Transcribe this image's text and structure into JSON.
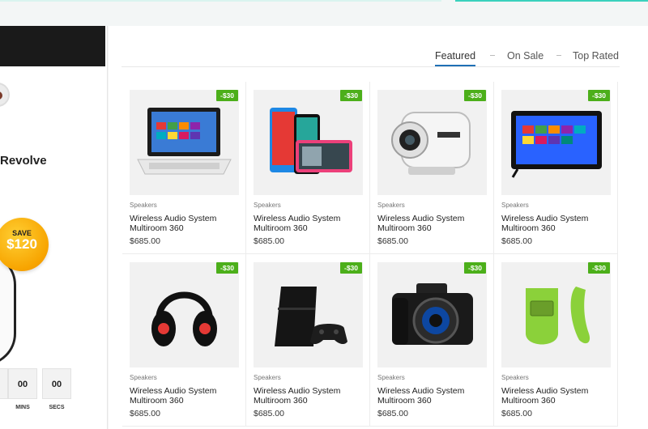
{
  "deal": {
    "title": "Revolve",
    "save_label": "SAVE",
    "save_amount": "$120",
    "timer": [
      {
        "value": "",
        "label": ""
      },
      {
        "value": "00",
        "label": "MINS"
      },
      {
        "value": "00",
        "label": "SECS"
      }
    ]
  },
  "tabs": [
    {
      "label": "Featured",
      "active": true
    },
    {
      "label": "On Sale",
      "active": false
    },
    {
      "label": "Top Rated",
      "active": false
    }
  ],
  "products": [
    {
      "image": "laptop-image",
      "badge": "-$30",
      "category": "Speakers",
      "name": "Wireless Audio System Multiroom 360",
      "price": "$685.00"
    },
    {
      "image": "smartphones-image",
      "badge": "-$30",
      "category": "Speakers",
      "name": "Wireless Audio System Multiroom 360",
      "price": "$685.00"
    },
    {
      "image": "action-camera-image",
      "badge": "-$30",
      "category": "Speakers",
      "name": "Wireless Audio System Multiroom 360",
      "price": "$685.00"
    },
    {
      "image": "tablet-image",
      "badge": "-$30",
      "category": "Speakers",
      "name": "Wireless Audio System Multiroom 360",
      "price": "$685.00"
    },
    {
      "image": "headphones-image",
      "badge": "-$30",
      "category": "Speakers",
      "name": "Wireless Audio System Multiroom 360",
      "price": "$685.00"
    },
    {
      "image": "game-console-image",
      "badge": "-$30",
      "category": "Speakers",
      "name": "Wireless Audio System Multiroom 360",
      "price": "$685.00"
    },
    {
      "image": "dslr-camera-image",
      "badge": "-$30",
      "category": "Speakers",
      "name": "Wireless Audio System Multiroom 360",
      "price": "$685.00"
    },
    {
      "image": "fitness-tracker-image",
      "badge": "-$30",
      "category": "Speakers",
      "name": "Wireless Audio System Multiroom 360",
      "price": "$685.00"
    }
  ],
  "colors": {
    "badge": "#4caf1a",
    "accent": "#1f6fb5",
    "save_badge": "#f7a400"
  }
}
